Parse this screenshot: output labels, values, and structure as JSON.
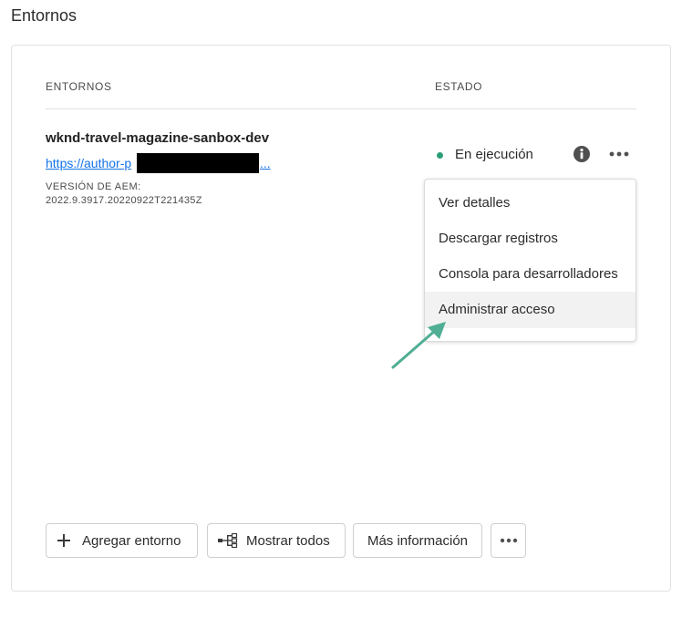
{
  "page": {
    "title": "Entornos"
  },
  "table": {
    "headers": {
      "environment": "ENTORNOS",
      "status": "ESTADO"
    }
  },
  "environment": {
    "name": "wknd-travel-magazine-sanbox-dev",
    "link_prefix": "https://author-p",
    "link_suffix": "...",
    "version_label": "VERSIÓN DE AEM:",
    "version_value": "2022.9.3917.20220922T221435Z",
    "status": "En ejecución",
    "status_color": "#2d9d78"
  },
  "menu": {
    "items": [
      {
        "label": "Ver detalles"
      },
      {
        "label": "Descargar registros"
      },
      {
        "label": "Consola para desarrolladores"
      },
      {
        "label": "Administrar acceso",
        "highlighted": true
      }
    ]
  },
  "footer": {
    "add_label": "Agregar entorno",
    "show_all_label": "Mostrar todos",
    "more_info_label": "Más información"
  },
  "icons": {
    "info": "info-icon",
    "more": "more-icon",
    "plus": "plus-icon",
    "tree": "tree-icon",
    "arrow": "arrow-annotation"
  },
  "colors": {
    "link": "#1473e6",
    "arrow": "#4fae94",
    "status_running": "#2d9d78"
  }
}
